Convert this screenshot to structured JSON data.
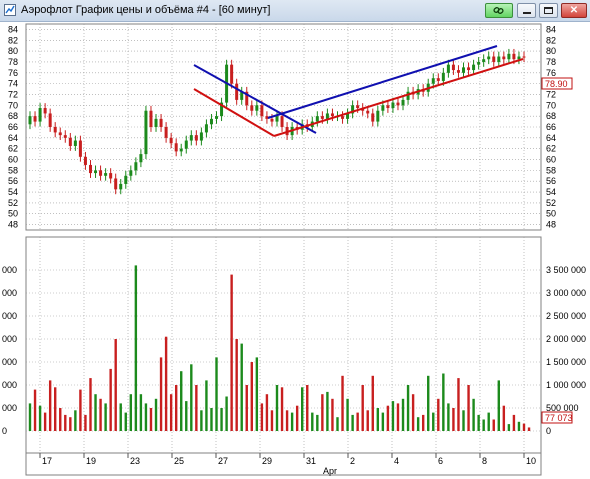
{
  "window": {
    "title": "Аэрофлот График цены и объёма #4 - [60 минут]",
    "buttons": {
      "link_icon": "link-icon",
      "minimize": "",
      "maximize": "",
      "close": "✕"
    }
  },
  "price_axis": {
    "labels": [
      "84",
      "82",
      "80",
      "78",
      "76",
      "74",
      "72",
      "70",
      "68",
      "66",
      "64",
      "62",
      "60",
      "58",
      "56",
      "54",
      "52",
      "50",
      "48"
    ],
    "min": 47,
    "max": 85,
    "last_value": "78.90",
    "last_value_color": "#c01010"
  },
  "volume_axis": {
    "right_labels": [
      "3 500 000",
      "3 000 000",
      "2 500 000",
      "2 000 000",
      "1 500 000",
      "1 000 000",
      "500 000",
      "0"
    ],
    "left_labels": [
      "000",
      "000",
      "000",
      "000",
      "000",
      "000",
      "000",
      "0"
    ],
    "max": 4000000,
    "last_value": "77 073",
    "last_value_color": "#c01010"
  },
  "date_axis": {
    "labels": [
      "17",
      "19",
      "23",
      "25",
      "27",
      "29",
      "31",
      "2",
      "4",
      "6",
      "8",
      "10"
    ],
    "month_label": "Apr"
  },
  "colors": {
    "up": "#1c8a1c",
    "down": "#c81f1f",
    "channel_blue": "#1010b0",
    "channel_red": "#d01010",
    "grid": "#9a9a9a"
  },
  "chart_data": {
    "type": "candlestick-volume",
    "price_range": [
      47,
      85
    ],
    "volume_range": [
      0,
      4000000
    ],
    "candles": [
      {
        "o": 66.5,
        "c": 68.0
      },
      {
        "o": 68.0,
        "c": 67.0
      },
      {
        "o": 67.0,
        "c": 69.5
      },
      {
        "o": 69.5,
        "c": 68.5
      },
      {
        "o": 68.5,
        "c": 66.0
      },
      {
        "o": 66.0,
        "c": 65.0
      },
      {
        "o": 65.0,
        "c": 64.5
      },
      {
        "o": 64.5,
        "c": 64.0
      },
      {
        "o": 64.0,
        "c": 62.5
      },
      {
        "o": 62.5,
        "c": 63.5
      },
      {
        "o": 63.5,
        "c": 60.5
      },
      {
        "o": 60.5,
        "c": 59.0
      },
      {
        "o": 59.0,
        "c": 57.5
      },
      {
        "o": 57.5,
        "c": 58.0
      },
      {
        "o": 58.0,
        "c": 57.0
      },
      {
        "o": 57.0,
        "c": 57.5
      },
      {
        "o": 57.5,
        "c": 56.5
      },
      {
        "o": 56.5,
        "c": 54.5
      },
      {
        "o": 54.5,
        "c": 55.5
      },
      {
        "o": 55.5,
        "c": 57.0
      },
      {
        "o": 57.0,
        "c": 58.0
      },
      {
        "o": 58.0,
        "c": 59.5
      },
      {
        "o": 59.5,
        "c": 61.0
      },
      {
        "o": 61.0,
        "c": 69.0
      },
      {
        "o": 69.0,
        "c": 66.0
      },
      {
        "o": 66.0,
        "c": 67.5
      },
      {
        "o": 67.5,
        "c": 66.0
      },
      {
        "o": 66.0,
        "c": 64.0
      },
      {
        "o": 64.0,
        "c": 63.0
      },
      {
        "o": 63.0,
        "c": 61.5
      },
      {
        "o": 61.5,
        "c": 62.0
      },
      {
        "o": 62.0,
        "c": 63.5
      },
      {
        "o": 63.5,
        "c": 64.5
      },
      {
        "o": 64.5,
        "c": 63.5
      },
      {
        "o": 63.5,
        "c": 65.0
      },
      {
        "o": 65.0,
        "c": 66.5
      },
      {
        "o": 66.5,
        "c": 67.5
      },
      {
        "o": 67.5,
        "c": 68.0
      },
      {
        "o": 68.0,
        "c": 70.5
      },
      {
        "o": 70.5,
        "c": 77.5
      },
      {
        "o": 77.5,
        "c": 74.0
      },
      {
        "o": 74.0,
        "c": 71.0
      },
      {
        "o": 71.0,
        "c": 72.5
      },
      {
        "o": 72.5,
        "c": 70.0
      },
      {
        "o": 70.0,
        "c": 69.0
      },
      {
        "o": 69.0,
        "c": 70.0
      },
      {
        "o": 70.0,
        "c": 68.0
      },
      {
        "o": 68.0,
        "c": 67.5
      },
      {
        "o": 67.5,
        "c": 67.0
      },
      {
        "o": 67.0,
        "c": 68.0
      },
      {
        "o": 68.0,
        "c": 66.0
      },
      {
        "o": 66.0,
        "c": 64.5
      },
      {
        "o": 64.5,
        "c": 66.0
      },
      {
        "o": 66.0,
        "c": 65.5
      },
      {
        "o": 65.5,
        "c": 66.5
      },
      {
        "o": 66.5,
        "c": 66.0
      },
      {
        "o": 66.0,
        "c": 67.0
      },
      {
        "o": 67.0,
        "c": 68.0
      },
      {
        "o": 68.0,
        "c": 67.5
      },
      {
        "o": 67.5,
        "c": 68.5
      },
      {
        "o": 68.5,
        "c": 68.0
      },
      {
        "o": 68.0,
        "c": 68.0
      },
      {
        "o": 68.0,
        "c": 67.5
      },
      {
        "o": 67.5,
        "c": 68.5
      },
      {
        "o": 68.5,
        "c": 70.0
      },
      {
        "o": 70.0,
        "c": 69.5
      },
      {
        "o": 69.5,
        "c": 69.0
      },
      {
        "o": 69.0,
        "c": 68.5
      },
      {
        "o": 68.5,
        "c": 67.0
      },
      {
        "o": 67.0,
        "c": 69.0
      },
      {
        "o": 69.0,
        "c": 70.0
      },
      {
        "o": 70.0,
        "c": 69.5
      },
      {
        "o": 69.5,
        "c": 70.5
      },
      {
        "o": 70.5,
        "c": 70.0
      },
      {
        "o": 70.0,
        "c": 71.0
      },
      {
        "o": 71.0,
        "c": 72.5
      },
      {
        "o": 72.5,
        "c": 72.0
      },
      {
        "o": 72.0,
        "c": 73.0
      },
      {
        "o": 73.0,
        "c": 72.5
      },
      {
        "o": 72.5,
        "c": 74.0
      },
      {
        "o": 74.0,
        "c": 75.0
      },
      {
        "o": 75.0,
        "c": 74.5
      },
      {
        "o": 74.5,
        "c": 76.0
      },
      {
        "o": 76.0,
        "c": 77.5
      },
      {
        "o": 77.5,
        "c": 76.5
      },
      {
        "o": 76.5,
        "c": 76.0
      },
      {
        "o": 76.0,
        "c": 77.0
      },
      {
        "o": 77.0,
        "c": 76.5
      },
      {
        "o": 76.5,
        "c": 77.5
      },
      {
        "o": 77.5,
        "c": 78.0
      },
      {
        "o": 78.0,
        "c": 78.5
      },
      {
        "o": 78.5,
        "c": 79.0
      },
      {
        "o": 79.0,
        "c": 78.0
      },
      {
        "o": 78.0,
        "c": 79.0
      },
      {
        "o": 79.0,
        "c": 78.5
      },
      {
        "o": 78.5,
        "c": 79.5
      },
      {
        "o": 79.5,
        "c": 78.5
      },
      {
        "o": 78.5,
        "c": 79.0
      },
      {
        "o": 79.0,
        "c": 78.9
      }
    ],
    "volumes": [
      600000,
      900000,
      550000,
      400000,
      1100000,
      950000,
      500000,
      350000,
      300000,
      450000,
      900000,
      350000,
      1150000,
      800000,
      700000,
      600000,
      1350000,
      2000000,
      600000,
      400000,
      800000,
      3600000,
      800000,
      600000,
      500000,
      700000,
      1600000,
      2050000,
      800000,
      1000000,
      1300000,
      650000,
      1450000,
      1000000,
      450000,
      1100000,
      500000,
      1600000,
      500000,
      750000,
      3400000,
      2000000,
      1900000,
      1000000,
      1500000,
      1600000,
      600000,
      800000,
      450000,
      1000000,
      950000,
      450000,
      400000,
      550000,
      950000,
      1000000,
      400000,
      350000,
      800000,
      850000,
      700000,
      300000,
      1200000,
      700000,
      350000,
      400000,
      1000000,
      450000,
      1200000,
      500000,
      400000,
      550000,
      650000,
      600000,
      700000,
      1000000,
      800000,
      300000,
      350000,
      1200000,
      400000,
      700000,
      1250000,
      600000,
      500000,
      1150000,
      450000,
      1000000,
      700000,
      350000,
      250000,
      400000,
      250000,
      1100000,
      550000,
      150000,
      350000,
      200000,
      160000,
      77073
    ]
  }
}
